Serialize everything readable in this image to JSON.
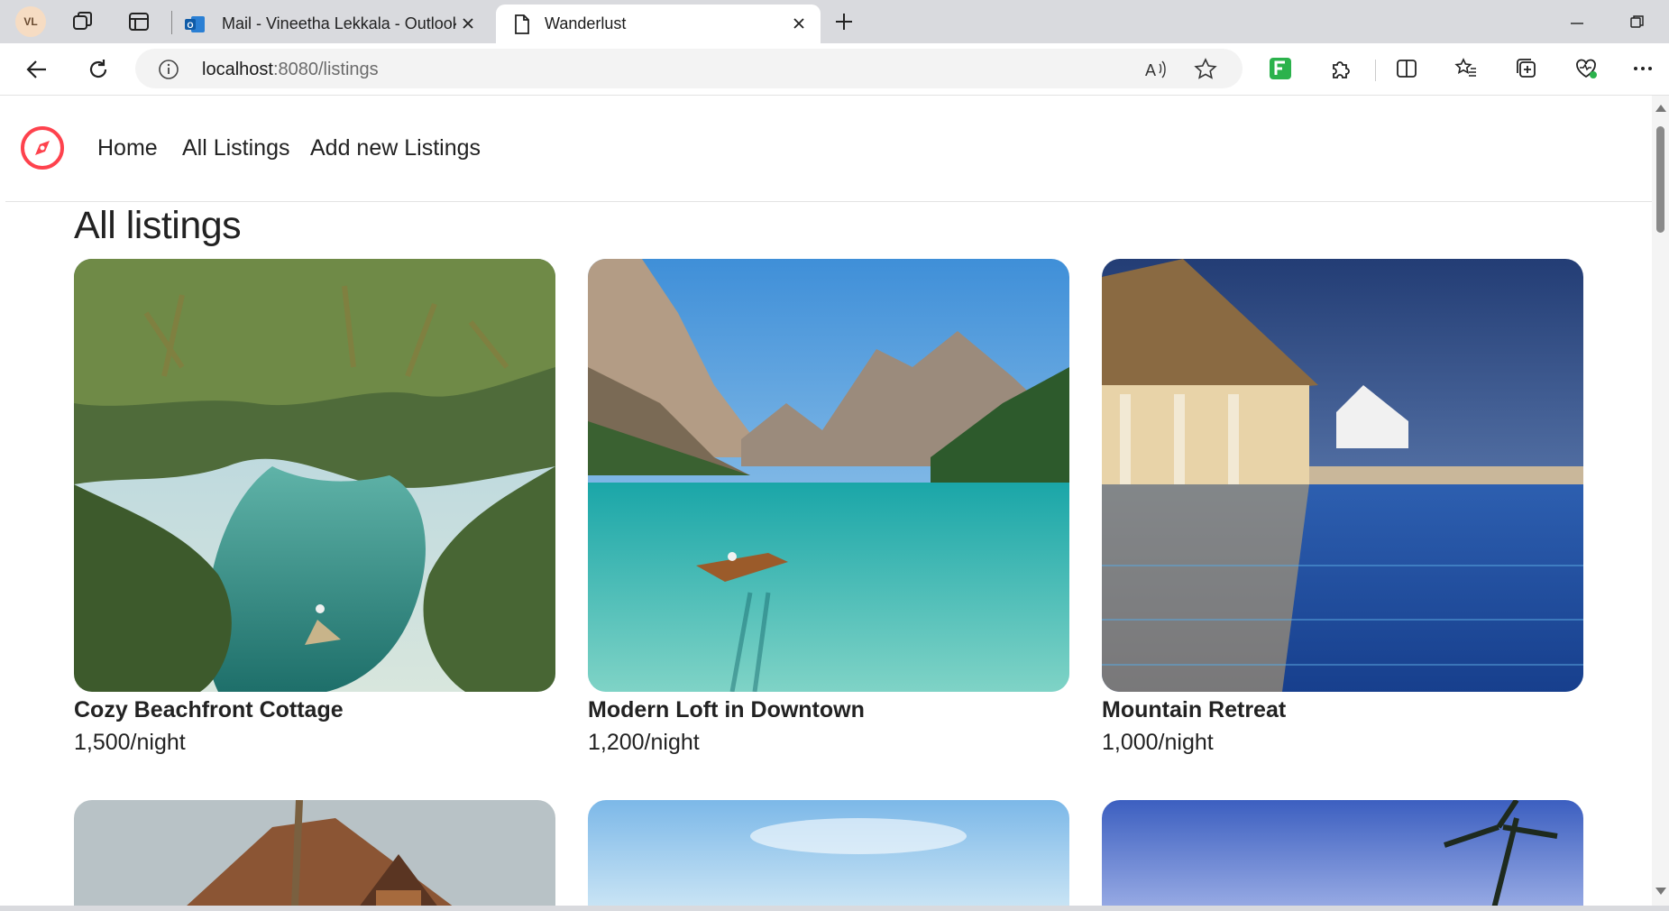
{
  "browser": {
    "profile_initials": "VL",
    "tabs": [
      {
        "title": "Mail - Vineetha Lekkala - Outlook",
        "icon": "outlook-icon"
      },
      {
        "title": "Wanderlust",
        "icon": "page-icon"
      }
    ],
    "url_host": "localhost",
    "url_rest": ":8080/listings"
  },
  "nav": {
    "logo": "compass-icon",
    "links": [
      "Home",
      "All Listings",
      "Add new Listings"
    ]
  },
  "page": {
    "heading": "All listings"
  },
  "listings": [
    {
      "title": "Cozy Beachfront Cottage",
      "price": "1,500/night"
    },
    {
      "title": "Modern Loft in Downtown",
      "price": "1,200/night"
    },
    {
      "title": "Mountain Retreat",
      "price": "1,000/night"
    }
  ],
  "colors": {
    "brand": "#fe424d",
    "text": "#222222"
  }
}
